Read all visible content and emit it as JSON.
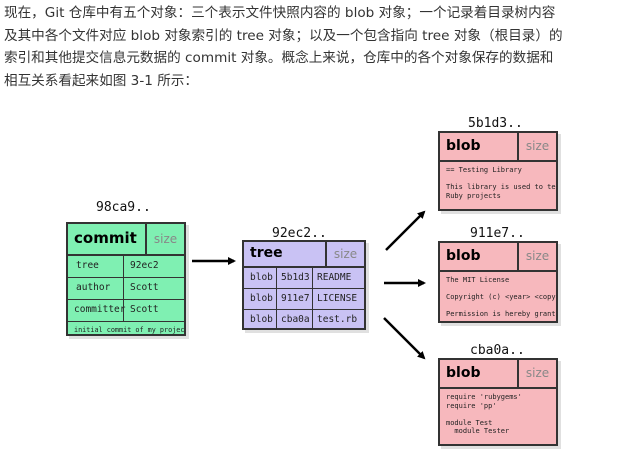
{
  "paragraph": {
    "line1": "现在，Git 仓库中有五个对象：三个表示文件快照内容的 blob 对象；一个记录着目录树内容",
    "line2": "及其中各个文件对应 blob 对象索引的 tree 对象；以及一个包含指向 tree 对象（根目录）的",
    "line3": "索引和其他提交信息元数据的 commit 对象。概念上来说，仓库中的各个对象保存的数据和",
    "line4": "相互关系看起来如图 3-1 所示："
  },
  "commit": {
    "hash": "98ca9..",
    "type": "commit",
    "size": "size",
    "rows": [
      {
        "key": "tree",
        "value": "92ec2"
      },
      {
        "key": "author",
        "value": "Scott"
      },
      {
        "key": "committer",
        "value": "Scott"
      }
    ],
    "message": "initial commit of my project"
  },
  "tree": {
    "hash": "92ec2..",
    "type": "tree",
    "size": "size",
    "rows": [
      {
        "kind": "blob",
        "hash": "5b1d3",
        "name": "README"
      },
      {
        "kind": "blob",
        "hash": "911e7",
        "name": "LICENSE"
      },
      {
        "kind": "blob",
        "hash": "cba0a",
        "name": "test.rb"
      }
    ]
  },
  "blobs": [
    {
      "hash": "5b1d3..",
      "type": "blob",
      "size": "size",
      "content": "== Testing Library\n\nThis library is used to test\nRuby projects"
    },
    {
      "hash": "911e7..",
      "type": "blob",
      "size": "size",
      "content": "The MIT License\n\nCopyright (c) <year> <copyright\n\nPermission is hereby granted,"
    },
    {
      "hash": "cba0a..",
      "type": "blob",
      "size": "size",
      "content": "require 'rubygems'\nrequire 'pp'\n\nmodule Test\n  module Tester"
    }
  ]
}
